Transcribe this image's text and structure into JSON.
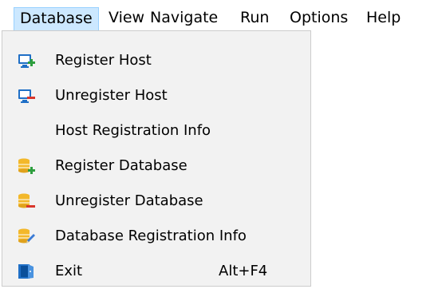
{
  "menubar": {
    "items": [
      {
        "label": "Database",
        "active": true
      },
      {
        "label": "View"
      },
      {
        "label": "Navigate"
      },
      {
        "label": "Run"
      },
      {
        "label": "Options"
      },
      {
        "label": "Help"
      }
    ]
  },
  "dropdown": {
    "items": [
      {
        "label": "Register Host",
        "icon": "monitor-add-icon"
      },
      {
        "label": "Unregister Host",
        "icon": "monitor-remove-icon"
      },
      {
        "label": "Host Registration Info",
        "icon": ""
      },
      {
        "label": "Register Database",
        "icon": "database-add-icon"
      },
      {
        "label": "Unregister Database",
        "icon": "database-remove-icon"
      },
      {
        "label": "Database Registration Info",
        "icon": "database-edit-icon"
      },
      {
        "label": "Exit",
        "icon": "exit-door-icon",
        "shortcut": "Alt+F4"
      }
    ]
  },
  "colors": {
    "active_menu_bg": "#cce8ff",
    "dropdown_bg": "#f2f2f2",
    "monitor_blue": "#1f6fc6",
    "plus_green": "#2e9e3e",
    "minus_red": "#d9362b",
    "database_yellow": "#f3b82a"
  }
}
